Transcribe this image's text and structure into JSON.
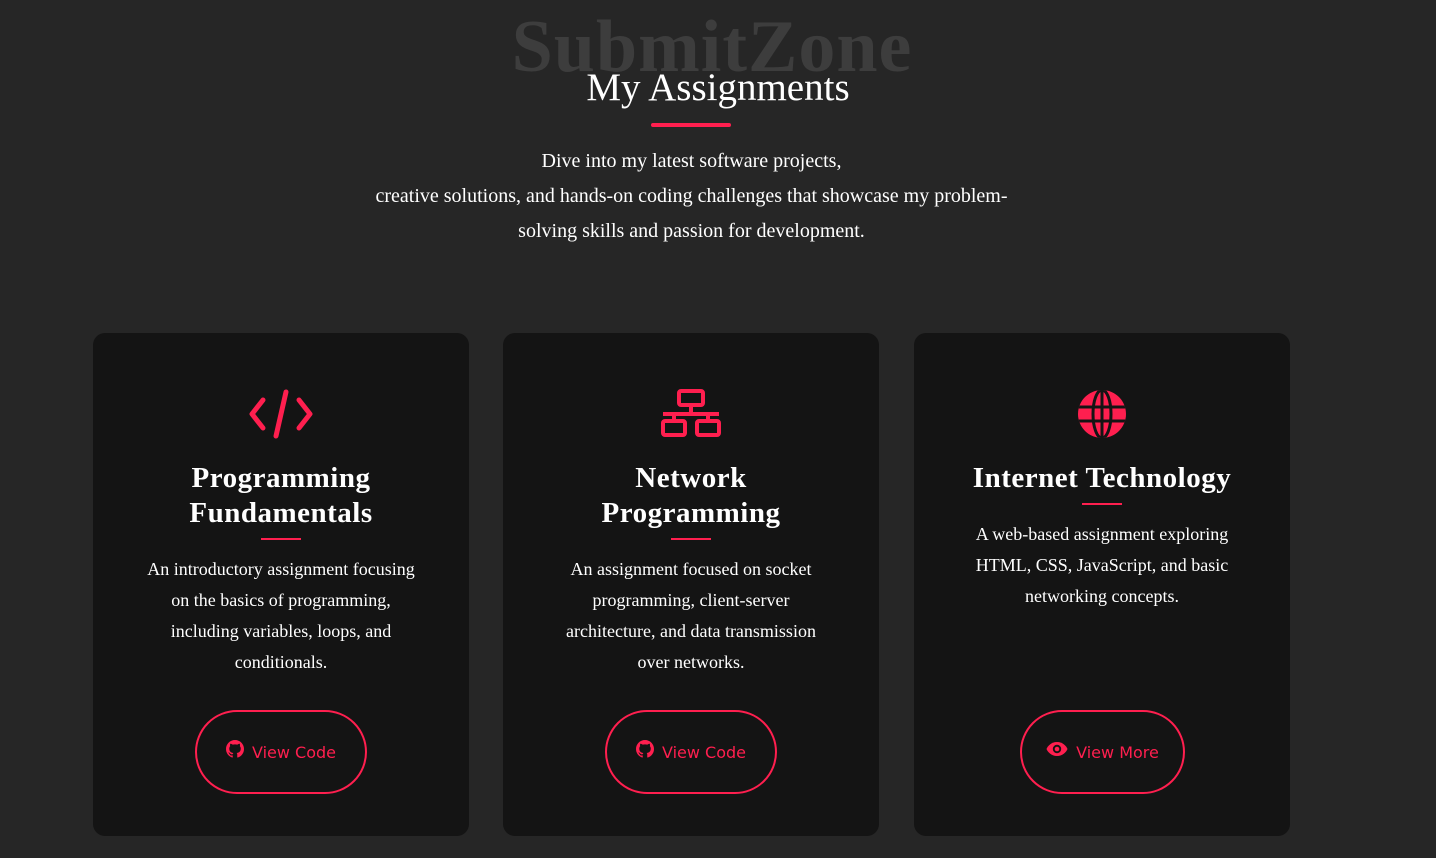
{
  "header": {
    "watermark": "SubmitZone",
    "title": "My Assignments",
    "intro_lines": [
      "Dive into my latest software projects,",
      "creative solutions, and hands-on coding challenges that showcase my problem-",
      "solving skills and passion for development."
    ]
  },
  "cards": [
    {
      "icon": "code-icon",
      "title_lines": [
        "Programming",
        "Fundamentals"
      ],
      "description_lines": [
        "An introductory assignment focusing",
        "on the basics of programming,",
        "including variables, loops, and",
        "conditionals."
      ],
      "button_icon": "github-icon",
      "button_label": "View Code"
    },
    {
      "icon": "network-icon",
      "title_lines": [
        "Network",
        "Programming"
      ],
      "description_lines": [
        "An assignment focused on socket",
        "programming, client-server",
        "architecture, and data transmission",
        "over networks."
      ],
      "button_icon": "github-icon",
      "button_label": "View Code"
    },
    {
      "icon": "globe-icon",
      "title_lines": [
        "Internet Technology"
      ],
      "description_lines": [
        "A web-based assignment exploring",
        "HTML, CSS, JavaScript, and basic",
        "networking concepts."
      ],
      "button_icon": "eye-icon",
      "button_label": "View More"
    }
  ],
  "colors": {
    "background": "#262626",
    "card_background": "#141414",
    "accent": "#ff1f4f",
    "watermark": "#3d3d3d",
    "text": "#ffffff"
  }
}
